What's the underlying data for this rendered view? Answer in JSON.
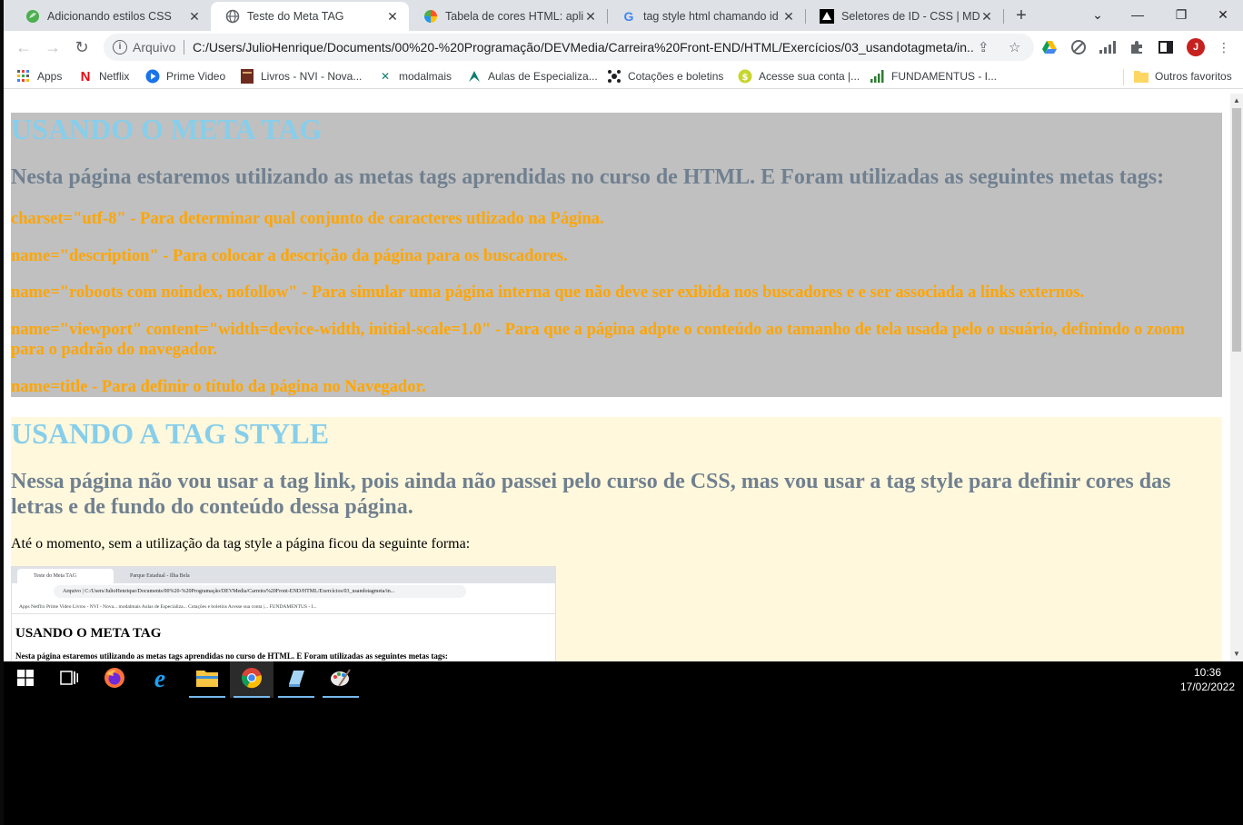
{
  "browser": {
    "tabs": [
      {
        "title": "Adicionando estilos CSS",
        "icon": "green-leaf-icon",
        "active": false
      },
      {
        "title": "Teste do Meta TAG",
        "icon": "globe-icon",
        "active": true
      },
      {
        "title": "Tabela de cores HTML: aplica",
        "icon": "color-wheel-icon",
        "active": false
      },
      {
        "title": "tag style html chamando id -",
        "icon": "google-icon",
        "active": false
      },
      {
        "title": "Seletores de ID - CSS | MDN",
        "icon": "mdn-icon",
        "active": false
      }
    ],
    "new_tab_label": "+",
    "window_controls": {
      "chevron": "⌄",
      "minimize": "—",
      "maximize": "❐",
      "close": "✕"
    },
    "address": {
      "scheme_label": "Arquivo",
      "url": "C:/Users/JulioHenrique/Documents/00%20-%20Programação/DEVMedia/Carreira%20Front-END/HTML/Exercícios/03_usandotagmeta/in..."
    },
    "profile_initial": "J",
    "bookmarks": [
      {
        "label": "Apps",
        "icon": "apps-grid-icon"
      },
      {
        "label": "Netflix",
        "icon": "netflix-icon"
      },
      {
        "label": "Prime Video",
        "icon": "prime-video-icon"
      },
      {
        "label": "Livros - NVI - Nova...",
        "icon": "book-icon"
      },
      {
        "label": "modalmais",
        "icon": "modalmais-icon"
      },
      {
        "label": "Aulas de Especializa...",
        "icon": "aulas-icon"
      },
      {
        "label": "Cotações e boletins",
        "icon": "cotacoes-icon"
      },
      {
        "label": "Acesse sua conta |...",
        "icon": "money-icon"
      },
      {
        "label": "FUNDAMENTUS - I...",
        "icon": "signal-bars-icon"
      }
    ],
    "other_bookmarks": "Outros favoritos"
  },
  "page": {
    "meta_section": {
      "heading": "USANDO O META TAG",
      "subheading": "Nesta página estaremos utilizando as metas tags aprendidas no curso de HTML. E Foram utilizadas as seguintes metas tags:",
      "items": [
        "charset=\"utf-8\" - Para determinar qual conjunto de caracteres utlizado na Página.",
        "name=\"description\" - Para colocar a descrição da página para os buscadores.",
        "name=\"roboots com noindex, nofollow\" - Para simular uma página interna que não deve ser exibida nos buscadores e e ser associada a links externos.",
        "name=\"viewport\" content=\"width=device-width, initial-scale=1.0\" - Para que a página adpte o conteúdo ao tamanho de tela usada pelo o usuário, definindo o zoom para o padrão do navegador.",
        "name=title - Para definir o título da página no Navegador."
      ]
    },
    "style_section": {
      "heading": "USANDO A TAG STYLE",
      "subheading": "Nessa página não vou usar a tag link, pois ainda não passei pelo curso de CSS, mas vou usar a tag style para definir cores das letras e de fundo do conteúdo dessa página.",
      "paragraph": "Até o momento, sem a utilização da tag style a página ficou da seguinte forma:"
    },
    "embedded_screenshot": {
      "tab1": "Teste do Meta TAG",
      "tab2": "Parque Estadual - Ilha Bela",
      "url": "Arquivo | C:/Users/JulioHenrique/Documents/00%20-%20Programação/DEVMedia/Carreira%20Front-END/HTML/Exercícios/03_usandotagmeta/in...",
      "bookmarks": "Apps   Netflix   Prime Video   Livros - NVI - Nova...   modalmais   Aulas de Especializa...   Cotações e boletins   Acesse sua conta |...   FUNDAMENTUS - I...",
      "heading": "USANDO O META TAG",
      "paragraph": "Nesta página estaremos utilizando as metas tags aprendidas no curso de HTML. E Foram utilizadas as seguintes metas tags:"
    }
  },
  "taskbar": {
    "apps": [
      {
        "name": "start-button",
        "icon": "windows-logo-icon"
      },
      {
        "name": "task-view",
        "icon": "task-view-icon"
      },
      {
        "name": "firefox",
        "icon": "firefox-icon"
      },
      {
        "name": "internet-explorer",
        "icon": "internet-explorer-icon"
      },
      {
        "name": "file-explorer",
        "icon": "folder-icon"
      },
      {
        "name": "chrome",
        "icon": "chrome-icon"
      },
      {
        "name": "notepad",
        "icon": "notepad-icon"
      },
      {
        "name": "paint",
        "icon": "paint-icon"
      }
    ],
    "time": "10:36",
    "date": "17/02/2022"
  },
  "colors": {
    "meta_bg": "#c0c0c0",
    "style_bg": "#fff8dc",
    "heading": "#87ceeb",
    "subheading": "#708090",
    "item_text": "#ffa500"
  }
}
